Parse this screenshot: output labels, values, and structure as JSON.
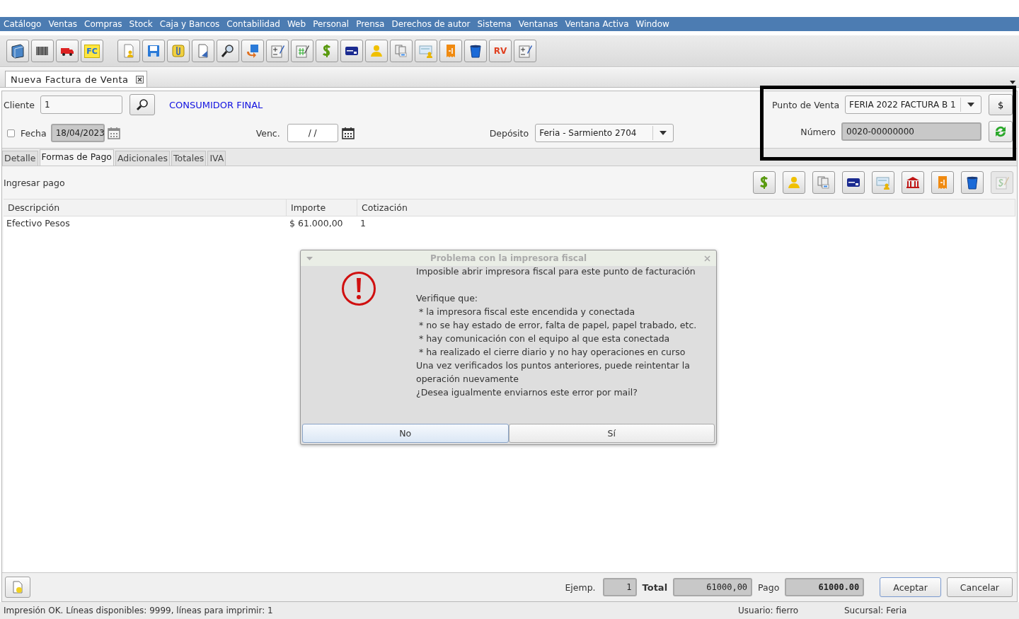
{
  "menu": [
    "Catálogo",
    "Ventas",
    "Compras",
    "Stock",
    "Caja y Bancos",
    "Contabilidad",
    "Web",
    "Personal",
    "Prensa",
    "Derechos de autor",
    "Sistema",
    "Ventanas",
    "Ventana Activa",
    "Window"
  ],
  "toolbar": [
    [
      {
        "kind": "book"
      },
      {
        "kind": "barcode"
      },
      {
        "kind": "truck"
      },
      {
        "kind": "letters",
        "text": "FC"
      }
    ],
    [
      {
        "kind": "doc-person"
      },
      {
        "kind": "floppy"
      },
      {
        "kind": "clip"
      },
      {
        "kind": "doc"
      },
      {
        "kind": "magnifier"
      },
      {
        "kind": "floppy-arrow"
      },
      {
        "kind": "calc-pencil"
      },
      {
        "kind": "hash-pencil"
      },
      {
        "kind": "dollar"
      },
      {
        "kind": "card"
      },
      {
        "kind": "person"
      },
      {
        "kind": "copies"
      },
      {
        "kind": "cheque"
      },
      {
        "kind": "receipt"
      },
      {
        "kind": "bin"
      },
      {
        "kind": "letters-magnifier",
        "text": "RV"
      },
      {
        "kind": "calc-pencil"
      }
    ]
  ],
  "document_tab": {
    "label": "Nueva Factura de Venta",
    "selected": true
  },
  "form": {
    "cliente_label": "Cliente",
    "cliente_value": "1",
    "cliente_name": "CONSUMIDOR FINAL",
    "fecha_checked": false,
    "fecha_label": "Fecha",
    "fecha_value": "18/04/2023",
    "venc_label": "Venc.",
    "venc_value": "/ /",
    "deposito_label": "Depósito",
    "deposito_value": "Feria - Sarmiento 2704",
    "punto_label": "Punto de Venta",
    "punto_value": "FERIA 2022 FACTURA B 1",
    "currency_button": "$",
    "numero_label": "Número",
    "numero_value": "0020-00000000"
  },
  "tabs": [
    {
      "label": "Detalle",
      "selected": false
    },
    {
      "label": "Formas de Pago",
      "selected": true
    },
    {
      "label": "Adicionales",
      "selected": false
    },
    {
      "label": "Totales",
      "selected": false
    },
    {
      "label": "IVA",
      "selected": false
    }
  ],
  "payments": {
    "title": "Ingresar pago",
    "buttons": [
      {
        "kind": "dollar",
        "disabled": false
      },
      {
        "kind": "person",
        "disabled": false
      },
      {
        "kind": "copies",
        "disabled": false
      },
      {
        "kind": "card",
        "disabled": false
      },
      {
        "kind": "cheque",
        "disabled": false
      },
      {
        "kind": "bank",
        "disabled": false
      },
      {
        "kind": "receipt",
        "disabled": false
      },
      {
        "kind": "bin",
        "disabled": false
      },
      {
        "kind": "money-pencil",
        "disabled": true
      }
    ]
  },
  "table": {
    "columns": [
      "Descripción",
      "Importe",
      "Cotización"
    ],
    "rows": [
      [
        "Efectivo Pesos",
        "$ 61.000,00",
        "1"
      ]
    ]
  },
  "footer": {
    "ejemplares_label": "Ejemp.",
    "ejemplares_value": "1",
    "total_label": "Total",
    "total_value": "61000,00",
    "pago_label": "Pago",
    "pago_value": "61000.00",
    "buttons": [
      "Aceptar",
      "Cancelar"
    ]
  },
  "status_bar": {
    "message": "Impresión OK. Líneas disponibles: 9999, líneas para imprimir: 1",
    "usuario": "Usuario: fierro",
    "sucursal": "Sucursal: Feria"
  },
  "dialog": {
    "title": "Problema con la impresora fiscal",
    "lines": [
      "Imposible abrir impresora fiscal para este punto de facturación",
      "Verifique que:",
      " * la impresora fiscal este encendida y conectada",
      " * no se hay estado de error, falta de papel, papel trabado, etc.",
      " * hay comunicación con el equipo al que esta conectada",
      " * ha realizado el cierre diario y no hay operaciones en curso",
      "Una vez verificados los puntos anteriores, puede reintentar la",
      "operación nuevamente",
      "¿Desea igualmente enviarnos este error por mail?"
    ],
    "buttons": [
      {
        "label": "No",
        "selected": true
      },
      {
        "label": "Sí",
        "selected": false
      }
    ]
  }
}
